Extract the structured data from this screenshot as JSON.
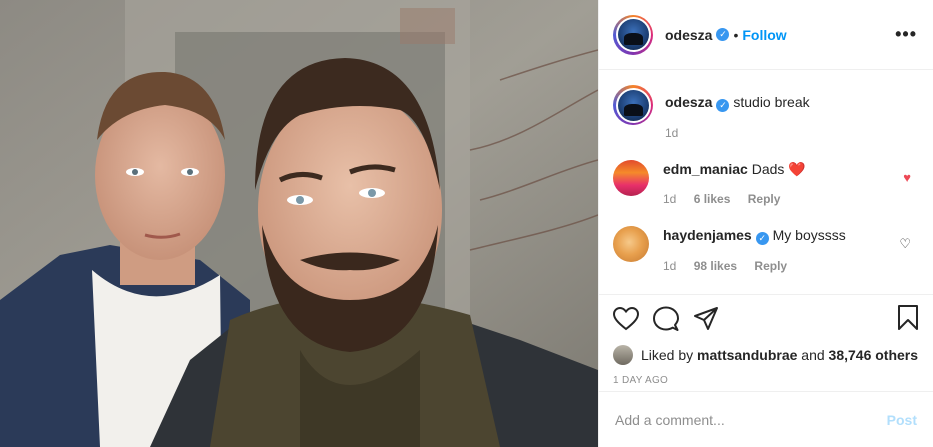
{
  "header": {
    "username": "odesza",
    "verified_glyph": "✓",
    "separator": "•",
    "follow_label": "Follow",
    "more_label": "•••"
  },
  "caption": {
    "username": "odesza",
    "text": "studio break",
    "time": "1d"
  },
  "comments": [
    {
      "username": "edm_maniac",
      "text": "Dads",
      "emoji": "❤️",
      "time": "1d",
      "likes": "6 likes",
      "reply": "Reply",
      "liked": true
    },
    {
      "username": "haydenjames",
      "text": "My boyssss",
      "time": "1d",
      "likes": "98 likes",
      "reply": "Reply",
      "liked": false
    }
  ],
  "icons": {
    "like": "heart-icon",
    "comment": "comment-icon",
    "share": "share-icon",
    "save": "bookmark-icon",
    "liked_heart": "♥",
    "unliked_heart": "♡"
  },
  "likes": {
    "prefix": "Liked by",
    "user": "mattsandubrae",
    "joiner": "and",
    "others": "38,746 others"
  },
  "timestamp": "1 DAY AGO",
  "add_comment": {
    "placeholder": "Add a comment...",
    "post_label": "Post"
  },
  "colors": {
    "accent": "#0095f6",
    "like_red": "#ed4956",
    "muted": "#8e8e8e",
    "post_disabled": "#b2dffc"
  }
}
